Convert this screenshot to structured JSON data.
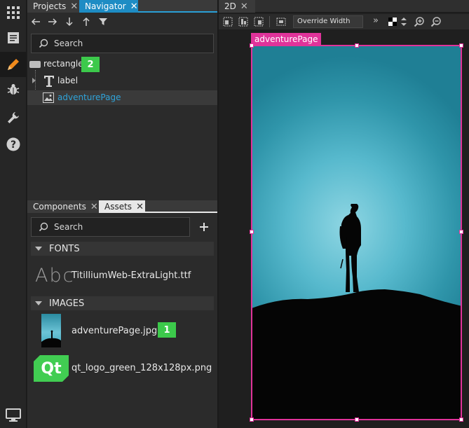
{
  "tabs": {
    "projects": "Projects",
    "navigator": "Navigator",
    "components": "Components",
    "assets": "Assets",
    "view2d": "2D"
  },
  "navigator": {
    "search_placeholder": "Search",
    "root_item": "rectangle",
    "root_badge": "2",
    "children": [
      "label",
      "adventurePage"
    ]
  },
  "assets": {
    "search_placeholder": "Search",
    "fonts_header": "FONTS",
    "font_preview": "Abc",
    "font_file": "TitilliumWeb-ExtraLight.ttf",
    "images_header": "IMAGES",
    "images": [
      {
        "name": "adventurePage.jpg",
        "badge": "1"
      },
      {
        "name": "qt_logo_green_128x128px.png",
        "badge": ""
      }
    ],
    "qt_logo_text": "Qt"
  },
  "toolbar2d": {
    "override_label": "Override Width"
  },
  "canvas": {
    "selected_item_label": "adventurePage"
  },
  "colors": {
    "accent": "#2a9fd6",
    "selection": "#e0339a",
    "badge_green": "#3cc94b",
    "link_blue": "#2fa4da"
  }
}
